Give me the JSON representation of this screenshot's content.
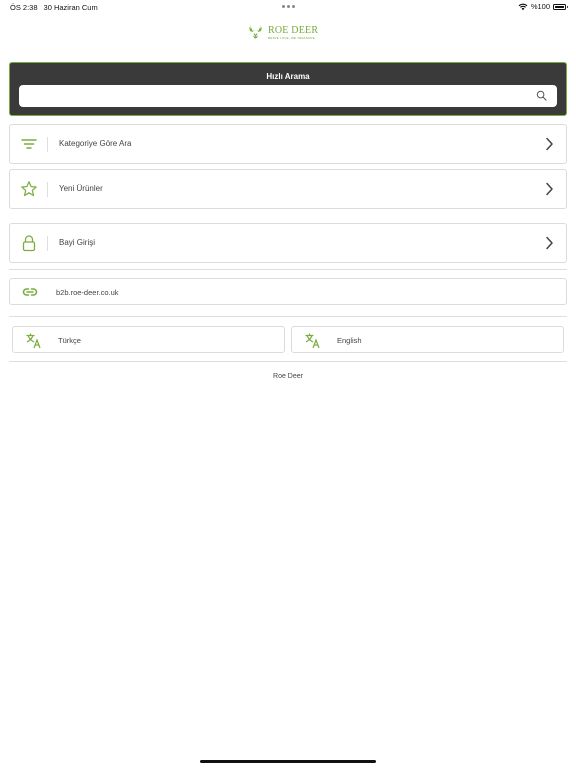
{
  "status_bar": {
    "time": "ÖS 2:38",
    "date": "30 Haziran Cum",
    "battery": "%100"
  },
  "logo": {
    "text": "ROE DEER",
    "tagline": "BRAVE LOVE, WE TREASURE"
  },
  "search": {
    "title": "Hızlı Arama",
    "value": "",
    "placeholder": "",
    "icon": "search-icon"
  },
  "menu": {
    "items": [
      {
        "label": "Kategoriye Göre Ara",
        "icon": "filter-icon"
      },
      {
        "label": "Yeni Ürünler",
        "icon": "star-icon"
      },
      {
        "label": "Bayi Girişi",
        "icon": "lock-icon"
      }
    ]
  },
  "link": {
    "label": "b2b.roe-deer.co.uk",
    "icon": "link-icon"
  },
  "languages": [
    {
      "label": "Türkçe",
      "icon": "translate-icon"
    },
    {
      "label": "English",
      "icon": "translate-icon"
    }
  ],
  "footer": {
    "text": "Roe Deer"
  },
  "colors": {
    "accent": "#79ae3e",
    "panel": "#3a3a3a",
    "border": "#dcdcdc"
  }
}
